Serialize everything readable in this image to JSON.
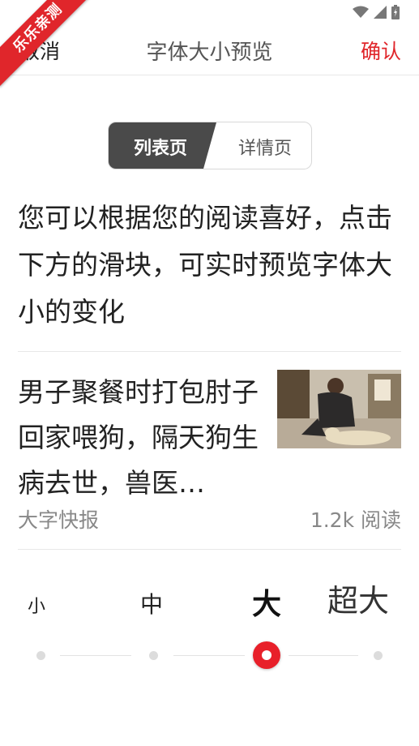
{
  "app_badge": "乐乐亲测",
  "header": {
    "cancel_label": "取消",
    "title": "字体大小预览",
    "confirm_label": "确认"
  },
  "tabs": {
    "active": "列表页",
    "inactive": "详情页"
  },
  "intro_text": "您可以根据您的阅读喜好，点击下方的滑块，可实时预览字体大小的变化",
  "article": {
    "title": "男子聚餐时打包肘子回家喂狗，隔天狗生病去世，兽医…",
    "source": "大字快报",
    "reads": "1.2k 阅读"
  },
  "font_sizes": {
    "small": "小",
    "medium": "中",
    "large": "大",
    "extra_large": "超大",
    "selected": "大"
  },
  "colors": {
    "accent": "#e0262b",
    "segment_active": "#4a4a4a"
  }
}
